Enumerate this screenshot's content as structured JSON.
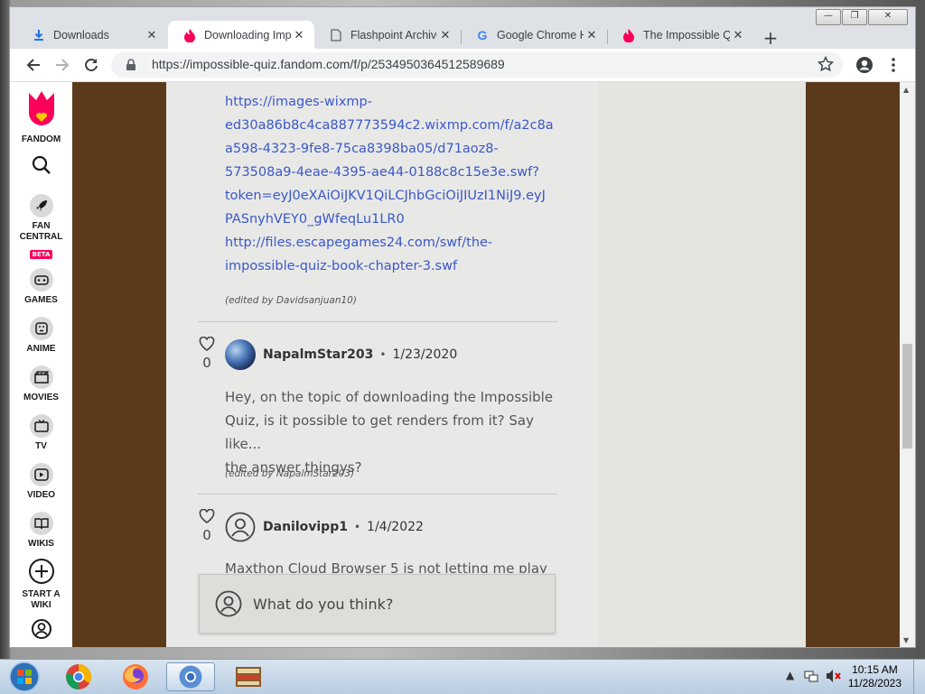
{
  "window": {
    "caption_buttons": [
      "minimize",
      "restore",
      "close"
    ]
  },
  "tabs": [
    {
      "title": "Downloads",
      "icon": "download-icon",
      "active": false
    },
    {
      "title": "Downloading Imp",
      "icon": "fandom-icon",
      "active": true
    },
    {
      "title": "Flashpoint Archive",
      "icon": "page-icon",
      "active": false
    },
    {
      "title": "Google Chrome H",
      "icon": "google-icon",
      "active": false
    },
    {
      "title": "The Impossible Qu",
      "icon": "fandom-icon",
      "active": false
    }
  ],
  "toolbar": {
    "url": "https://impossible-quiz.fandom.com/f/p/2534950364512589689"
  },
  "rail": {
    "brand": "FANDOM",
    "items": [
      {
        "label": "FAN CENTRAL",
        "badge": "BETA",
        "icon": "rocket-icon"
      },
      {
        "label": "GAMES",
        "icon": "gamepad-icon"
      },
      {
        "label": "ANIME",
        "icon": "anime-face-icon"
      },
      {
        "label": "MOVIES",
        "icon": "clapperboard-icon"
      },
      {
        "label": "TV",
        "icon": "tv-icon"
      },
      {
        "label": "VIDEO",
        "icon": "play-icon"
      },
      {
        "label": "WIKIS",
        "icon": "book-icon"
      },
      {
        "label": "START A WIKI",
        "icon": "plus-circle-icon"
      }
    ]
  },
  "post": {
    "links": [
      "https://images-wixmp-",
      "ed30a86b8c4ca887773594c2.wixmp.com/f/a2c8a",
      "a598-4323-9fe8-75ca8398ba05/d71aoz8-",
      "573508a9-4eae-4395-ae44-0188c8c15e3e.swf?",
      "token=eyJ0eXAiOiJKV1QiLCJhbGciOiJIUzI1NiJ9.eyJ",
      "PASnyhVEY0_gWfeqLu1LR0",
      "http://files.escapegames24.com/swf/the-",
      "impossible-quiz-book-chapter-3.swf"
    ],
    "edited": "(edited by Davidsanjuan10)"
  },
  "replies": [
    {
      "author": "NapalmStar203",
      "date": "1/23/2020",
      "likes": "0",
      "text": [
        "Hey, on the topic of downloading the Impossible",
        "Quiz, is it possible to get renders from it? Say like...",
        "the answer thingys?"
      ],
      "edited": "(edited by NapalmStar203)"
    },
    {
      "author": "Danilovipp1",
      "date": "1/4/2022",
      "likes": "0",
      "text": [
        "Maxthon Cloud Browser 5 is not letting me play"
      ]
    }
  ],
  "reply_box": {
    "placeholder": "What do you think?"
  },
  "taskbar": {
    "time": "10:15 AM",
    "date": "11/28/2023"
  }
}
